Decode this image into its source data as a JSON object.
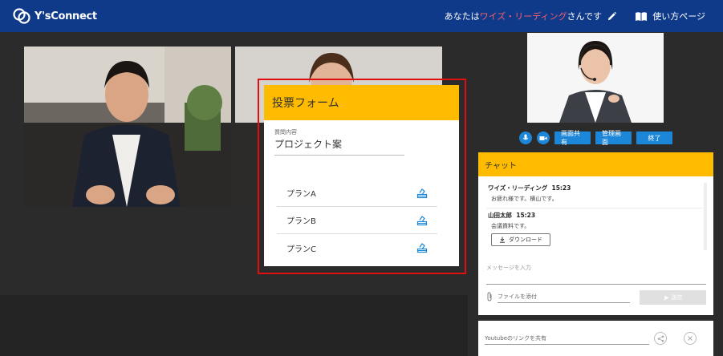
{
  "header": {
    "logo_text": "Y'sConnect",
    "user_prefix": "あなたは",
    "user_name": "ワイズ・リーディング",
    "user_suffix": "さんです",
    "guide_label": "使い方ページ"
  },
  "controls": {
    "screen_share": "画面共有",
    "manage_screen": "管理画面",
    "end": "終了"
  },
  "vote_form": {
    "title": "投票フォーム",
    "question_label": "質問内容",
    "question_value": "プロジェクト案",
    "options": [
      "プランA",
      "プランB",
      "プランC"
    ]
  },
  "chat": {
    "title": "チャット",
    "messages": [
      {
        "author": "ワイズ・リーディング",
        "time": "15:23",
        "text": "お疲れ様です。横山です。"
      },
      {
        "author": "山田太郎",
        "time": "15:23",
        "text": "会議資料です。",
        "download_label": "ダウンロード"
      }
    ],
    "input_placeholder": "メッセージを入力",
    "attach_label": "ファイルを添付",
    "send_label": "送信"
  },
  "youtube": {
    "placeholder": "Youtubeのリンクを共有"
  },
  "colors": {
    "header": "#0f3a8a",
    "accent": "#ffbb00",
    "button": "#1c86d8",
    "highlight": "#e01010",
    "user_name": "#ff5c6c"
  }
}
